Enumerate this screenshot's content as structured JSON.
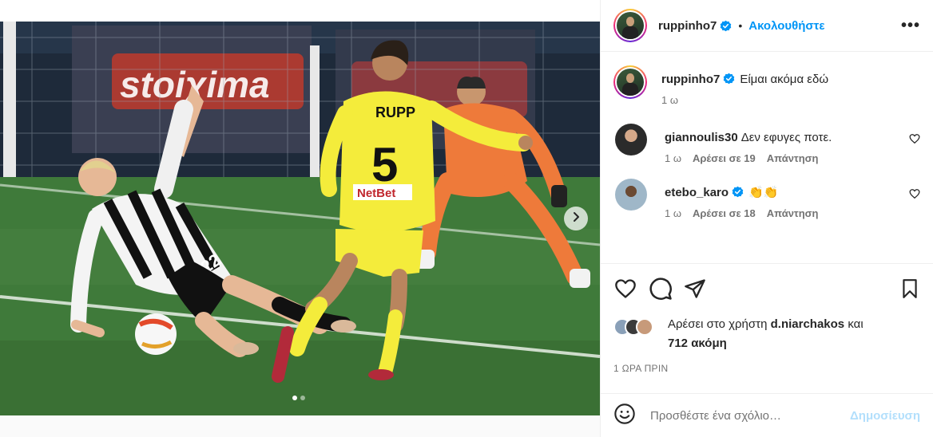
{
  "post": {
    "author": "ruppinho7",
    "follow_label": "Ακολουθήστε",
    "separator": "•",
    "more_label": "•••",
    "caption": "Είμαι ακόμα εδώ",
    "caption_age": "1 ω"
  },
  "photo": {
    "banner_text": "stoiχima",
    "jersey_name": "RUPP",
    "jersey_number": "5",
    "sponsor": "NetBet",
    "opponent_number": "22",
    "carousel_count": 2,
    "carousel_active": 0
  },
  "comments": [
    {
      "user": "giannoulis30",
      "verified": false,
      "text": "Δεν εφυγες ποτε.",
      "age": "1 ω",
      "likes": "Αρέσει σε 19",
      "reply": "Απάντηση"
    },
    {
      "user": "etebo_karo",
      "verified": true,
      "text": "👏👏",
      "age": "1 ω",
      "likes": "Αρέσει σε 18",
      "reply": "Απάντηση"
    }
  ],
  "likes": {
    "prefix": "Αρέσει στο χρήστη",
    "user": "d.niarchakos",
    "joiner": "και",
    "count": "712 ακόμη"
  },
  "timestamp": "1 ΩΡΑ ΠΡΙΝ",
  "add_comment": {
    "placeholder": "Προσθέστε ένα σχόλιο…",
    "post_label": "Δημοσίευση"
  },
  "colors": {
    "accent": "#0095f6",
    "post_disabled": "#b2dffc",
    "secondary_text": "#737373"
  }
}
